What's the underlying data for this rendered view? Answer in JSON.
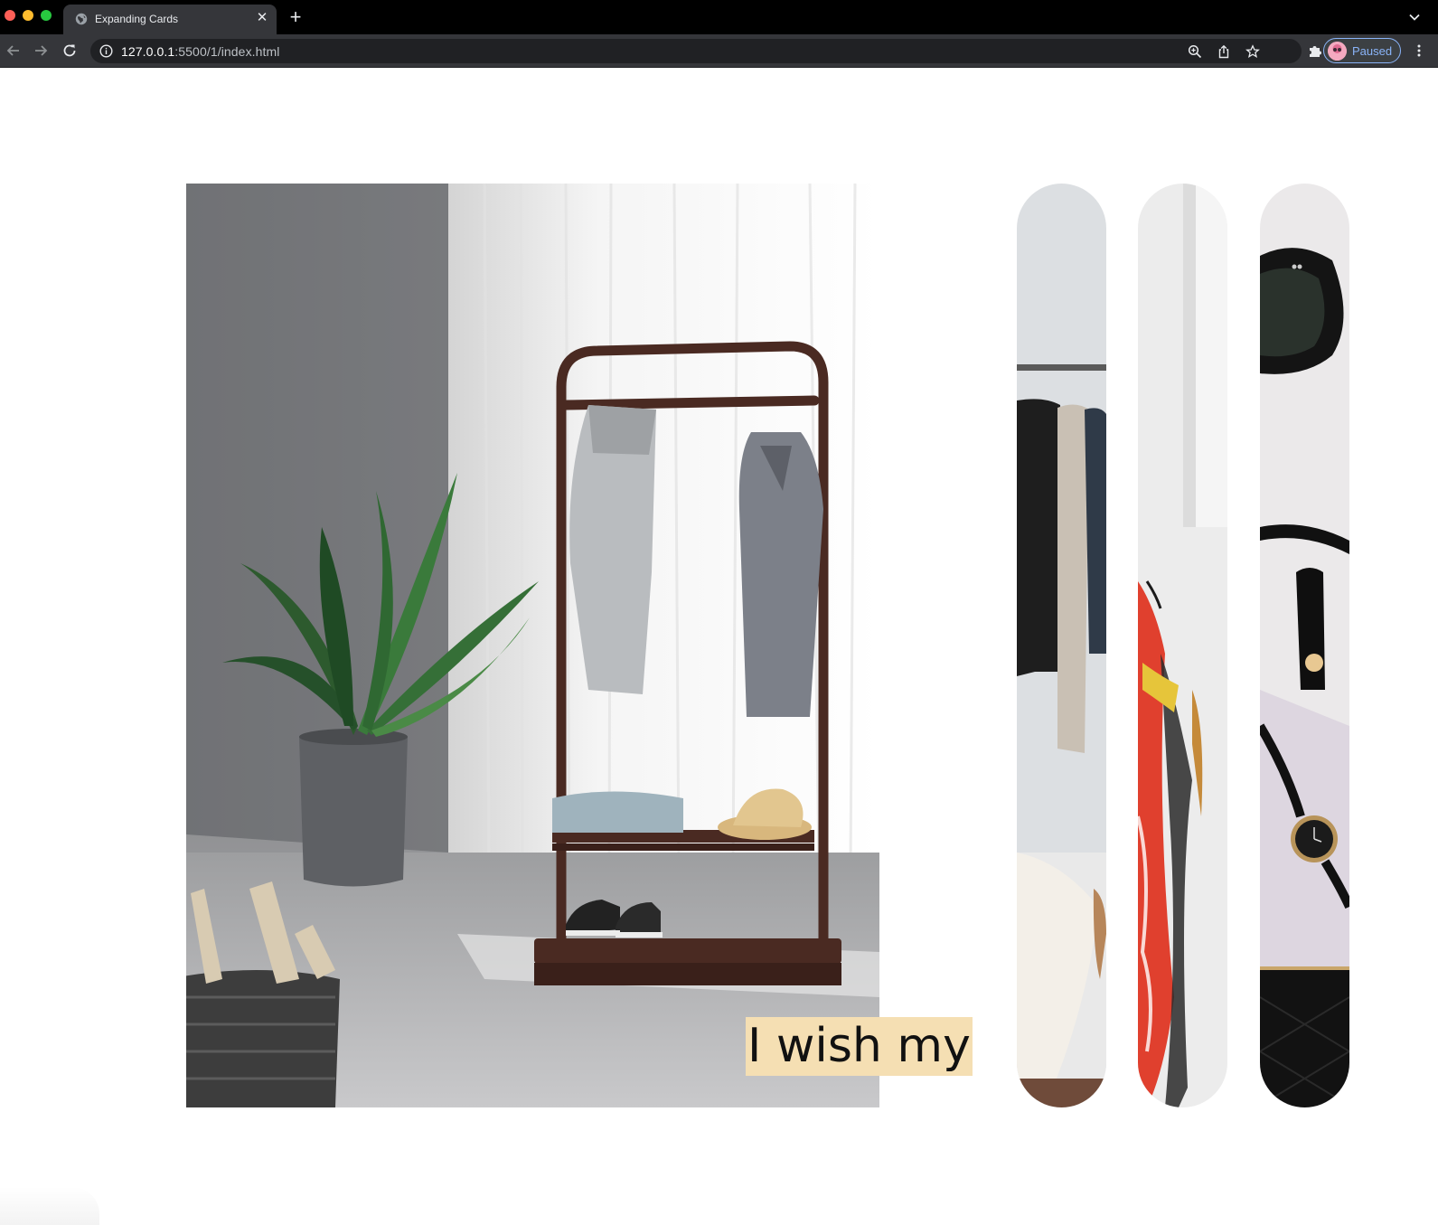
{
  "browser": {
    "tab": {
      "title": "Expanding Cards",
      "favicon": "globe-icon",
      "close_icon": "close-icon"
    },
    "new_tab_icon": "plus-icon",
    "tab_search_icon": "chevron-down-icon",
    "nav": {
      "back_icon": "arrow-left-icon",
      "forward_icon": "arrow-right-icon",
      "reload_icon": "reload-icon"
    },
    "address": {
      "info_icon": "info-icon",
      "host": "127.0.0.1",
      "rest": ":5500/1/index.html"
    },
    "actions": [
      "zoom-icon",
      "share-icon",
      "star-icon",
      "extensions-icon"
    ],
    "profile": {
      "label": "Paused"
    },
    "menu_icon": "kebab-menu-icon"
  },
  "page": {
    "active_caption": "I wish my",
    "panels": [
      {
        "name": "clothes-rack-and-plant",
        "active": true
      },
      {
        "name": "hanging-jackets",
        "active": false
      },
      {
        "name": "fashion-illustration",
        "active": false
      },
      {
        "name": "sunglasses-and-watch",
        "active": false
      }
    ]
  }
}
